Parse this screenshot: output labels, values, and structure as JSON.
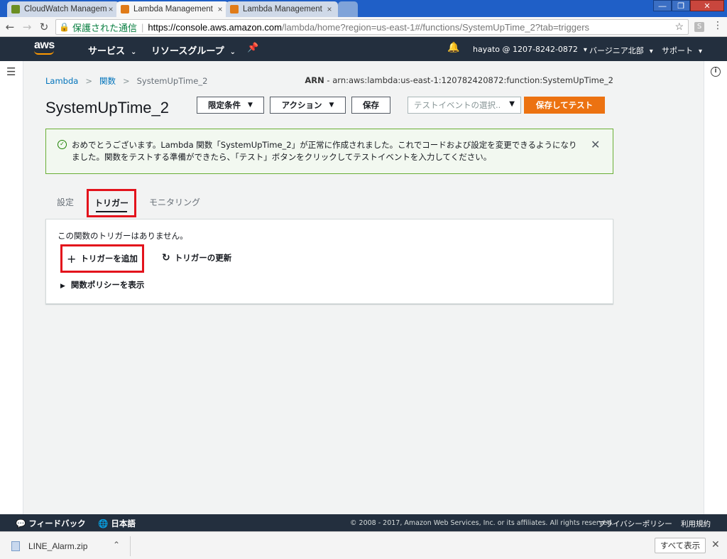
{
  "browser": {
    "tabs": [
      {
        "title": "CloudWatch Managem",
        "close": "×"
      },
      {
        "title": "Lambda Management",
        "close": "×"
      },
      {
        "title": "Lambda Management",
        "close": "×"
      }
    ],
    "url": {
      "secure_label": "保護された通信",
      "scheme_host": "https://console.aws.amazon.com",
      "path": "/lambda/home?region=us-east-1#/functions/SystemUpTime_2?tab=triggers"
    }
  },
  "awsnav": {
    "logo": "aws",
    "services": "サービス",
    "resource_groups": "リソースグループ",
    "account": "hayato @ 1207-8242-0872",
    "region": "バージニア北部",
    "support": "サポート"
  },
  "breadcrumb": {
    "root": "Lambda",
    "functions": "関数",
    "current": "SystemUpTime_2"
  },
  "arn": {
    "label": "ARN",
    "value": " - arn:aws:lambda:us-east-1:120782420872:function:SystemUpTime_2"
  },
  "function": {
    "title": "SystemUpTime_2"
  },
  "buttons": {
    "qualifiers": "限定条件",
    "actions": "アクション",
    "save": "保存",
    "test_event_placeholder": "テストイベントの選択..",
    "save_and_test": "保存してテスト"
  },
  "flash": {
    "message": "おめでとうございます。Lambda 関数「SystemUpTime_2」が正常に作成されました。これでコードおよび設定を変更できるようになりました。関数をテストする準備ができたら、「テスト」ボタンをクリックしてテストイベントを入力してください。"
  },
  "tabs": {
    "settings": "設定",
    "triggers": "トリガー",
    "monitoring": "モニタリング"
  },
  "triggers_panel": {
    "empty_message": "この関数のトリガーはありません。",
    "add": "トリガーを追加",
    "refresh": "トリガーの更新",
    "show_policy": "関数ポリシーを表示"
  },
  "footer": {
    "feedback": "フィードバック",
    "language": "日本語",
    "copyright": "© 2008 - 2017, Amazon Web Services, Inc. or its affiliates. All rights reserved.",
    "privacy": "プライバシーポリシー",
    "terms": "利用規約"
  },
  "downloads": {
    "file": "LINE_Alarm.zip",
    "show_all": "すべて表示"
  },
  "colors": {
    "aws_nav": "#232f3e",
    "primary_button": "#ec7211",
    "success_border": "#6aaf35",
    "highlight_box": "#e3131c",
    "link": "#0073bb"
  }
}
